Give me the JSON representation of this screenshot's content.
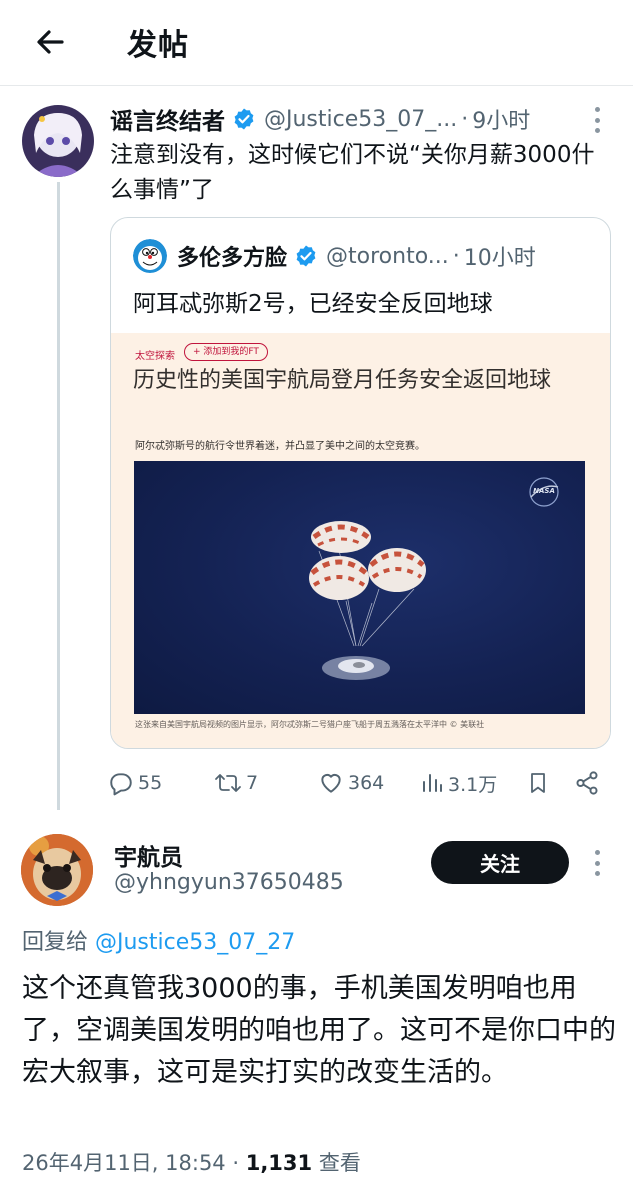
{
  "header": {
    "title": "发帖",
    "back_icon": "arrow-left-icon"
  },
  "parent_post": {
    "display_name": "谣言终结者",
    "handle": "@Justice53_07_...",
    "separator": "·",
    "time": "9小时",
    "text": "注意到没有，这时候它们不说“关你月薪3000什么事情”了",
    "quoted_post": {
      "display_name": "多伦多方脸",
      "handle": "@toronto...",
      "separator": "·",
      "time": "10小时",
      "text": "阿耳忒弥斯2号，已经安全反回地球",
      "article": {
        "section": "太空探索",
        "follow_label": "+ 添加到我的FT",
        "headline": "历史性的美国宇航局登月任务安全返回地球",
        "standfirst": "阿尔忒弥斯号的航行令世界着迷，并凸显了美中之间的太空竞赛。",
        "photo_logo": "NASA",
        "caption": "这张来自美国宇航局视频的图片显示，阿尔忒弥斯二号猎户座飞船于周五溅落在太平洋中 © 美联社"
      }
    },
    "actions": {
      "replies": "55",
      "reposts": "7",
      "likes": "364",
      "views": "3.1万"
    }
  },
  "reply_post": {
    "display_name": "宇航员",
    "handle": "@yhngyun37650485",
    "follow_label": "关注",
    "reply_to_prefix": "回复给 ",
    "reply_to_handle": "@Justice53_07_27",
    "text": "这个还真管我3000的事，手机美国发明咱也用了，空调美国发明的咱也用了。这可不是你口中的宏大叙事，这可是实打实的改变生活的。",
    "date": "26年4月11日, 18:54",
    "separator": " · ",
    "views_count": "1,131",
    "views_label": " 查看"
  },
  "colors": {
    "accent_blue": "#1d9bf0",
    "text_primary": "#0f1419",
    "text_secondary": "#536471",
    "ft_background": "#fdf1e5",
    "ft_red": "#c0143c"
  }
}
